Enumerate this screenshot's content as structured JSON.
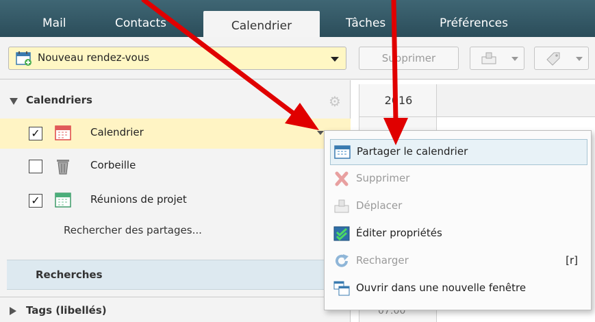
{
  "tabs": [
    {
      "label": "Mail"
    },
    {
      "label": "Contacts"
    },
    {
      "label": "Calendrier"
    },
    {
      "label": "Tâches"
    },
    {
      "label": "Préférences"
    }
  ],
  "toolbar": {
    "new_appointment_label": "Nouveau rendez-vous",
    "delete_label": "Supprimer"
  },
  "sidebar": {
    "calendars_header": "Calendriers",
    "calendars": [
      {
        "name": "Calendrier",
        "checked": "✓",
        "color": "#e05a5a"
      },
      {
        "name": "Corbeille",
        "checked": "",
        "color": "#888888"
      },
      {
        "name": "Réunions de projet",
        "checked": "✓",
        "color": "#4bae7a"
      }
    ],
    "search_shares": "Rechercher des partages...",
    "searches_header": "Recherches",
    "tags_header": "Tags (libellés)"
  },
  "calendar_grid": {
    "year": "2016",
    "time": "07:00"
  },
  "context_menu": {
    "items": [
      {
        "label": "Partager le calendrier",
        "icon": "calendar-share-icon",
        "disabled": false
      },
      {
        "label": "Supprimer",
        "icon": "delete-x-icon",
        "disabled": true
      },
      {
        "label": "Déplacer",
        "icon": "move-icon",
        "disabled": true
      },
      {
        "label": "Éditer propriétés",
        "icon": "edit-properties-icon",
        "disabled": false
      },
      {
        "label": "Recharger",
        "icon": "reload-icon",
        "disabled": true,
        "shortcut": "[r]"
      },
      {
        "label": "Ouvrir dans une nouvelle fenêtre",
        "icon": "new-window-icon",
        "disabled": false
      }
    ]
  },
  "colors": {
    "tabbar": "#2f5866",
    "selected_row": "#fff4c4",
    "menu_highlight": "#e8f2f7",
    "annotation_arrow": "#e00000"
  }
}
